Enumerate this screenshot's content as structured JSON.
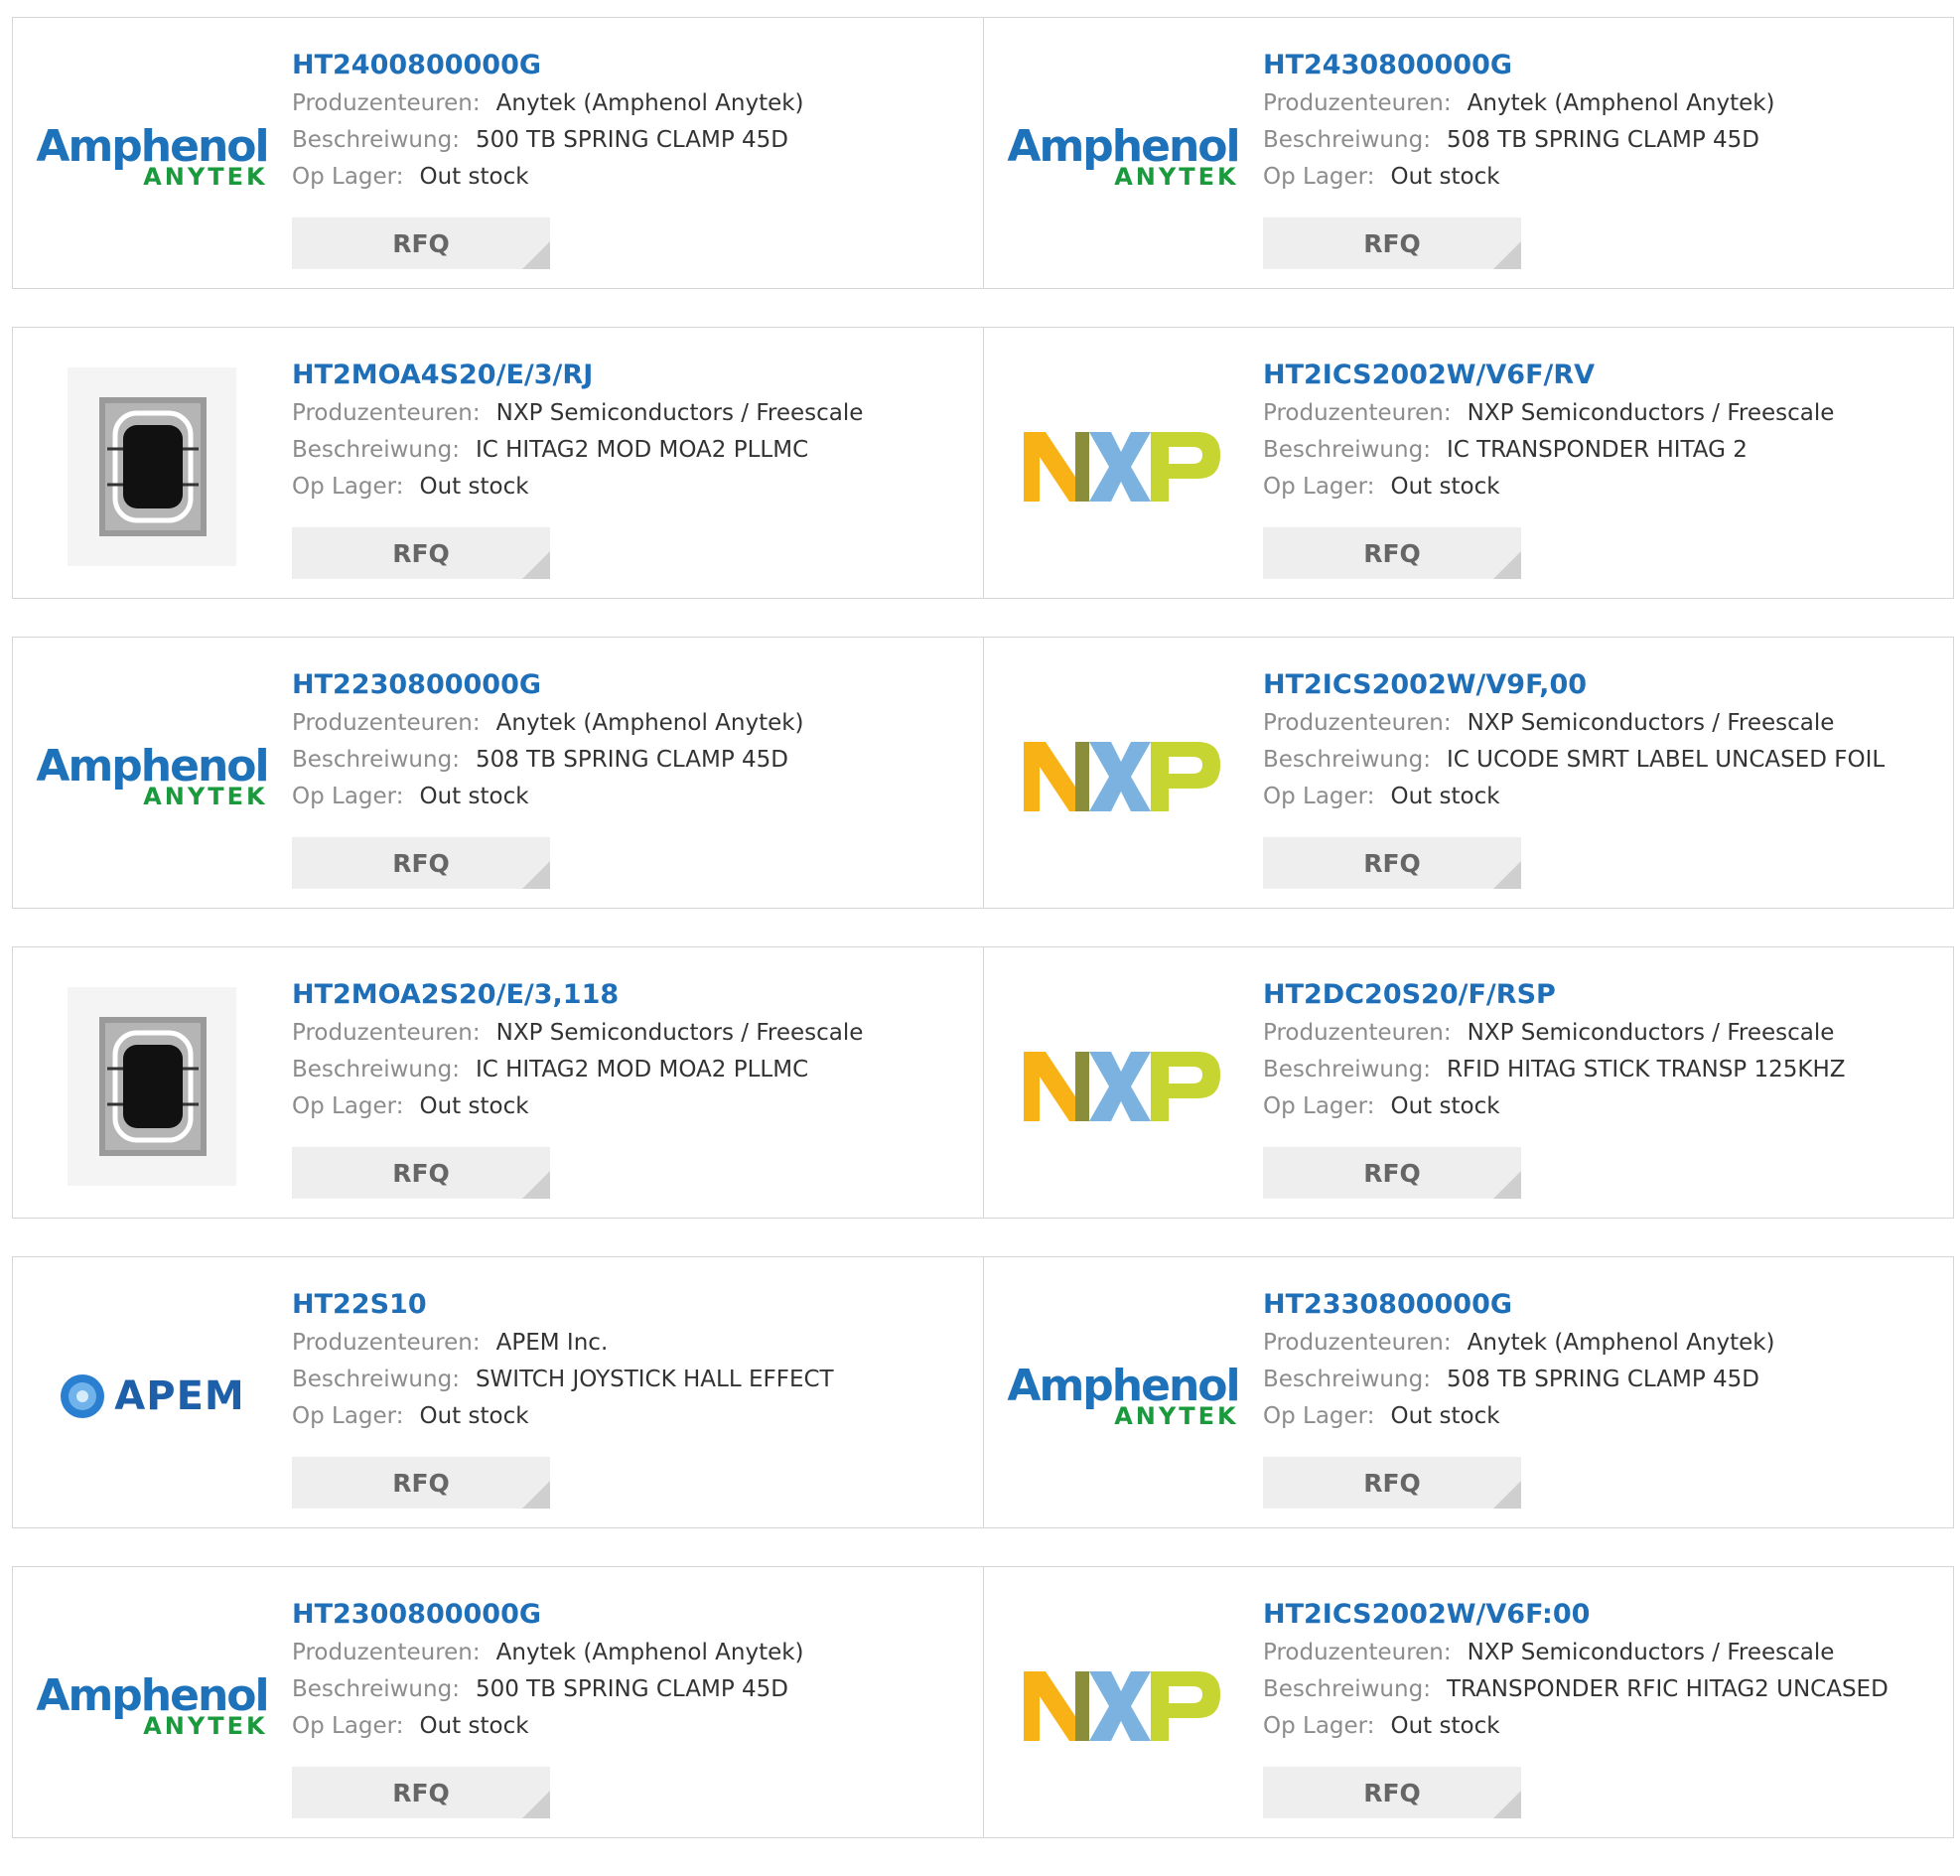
{
  "labels": {
    "manufacturer": "Produzenteuren:",
    "description": "Beschreiwung:",
    "stock": "Op Lager:",
    "rfq": "RFQ"
  },
  "logos": {
    "amphenol_top": "Amphenol",
    "amphenol_bottom": "ANYTEK",
    "apem": "APEM"
  },
  "products": [
    {
      "part": "HT2400800000G",
      "manufacturer": "Anytek (Amphenol Anytek)",
      "description": "500 TB SPRING CLAMP 45D",
      "stock": "Out stock",
      "logo": "amphenol-anytek-logo"
    },
    {
      "part": "HT2430800000G",
      "manufacturer": "Anytek (Amphenol Anytek)",
      "description": "508 TB SPRING CLAMP 45D",
      "stock": "Out stock",
      "logo": "amphenol-anytek-logo"
    },
    {
      "part": "HT2MOA4S20/E/3/RJ",
      "manufacturer": "NXP Semiconductors / Freescale",
      "description": "IC HITAG2 MOD MOA2 PLLMC",
      "stock": "Out stock",
      "logo": "chip-module-image"
    },
    {
      "part": "HT2ICS2002W/V6F/RV",
      "manufacturer": "NXP Semiconductors / Freescale",
      "description": "IC TRANSPONDER HITAG 2",
      "stock": "Out stock",
      "logo": "nxp-logo"
    },
    {
      "part": "HT2230800000G",
      "manufacturer": "Anytek (Amphenol Anytek)",
      "description": "508 TB SPRING CLAMP 45D",
      "stock": "Out stock",
      "logo": "amphenol-anytek-logo"
    },
    {
      "part": "HT2ICS2002W/V9F,00",
      "manufacturer": "NXP Semiconductors / Freescale",
      "description": "IC UCODE SMRT LABEL UNCASED FOIL",
      "stock": "Out stock",
      "logo": "nxp-logo"
    },
    {
      "part": "HT2MOA2S20/E/3,118",
      "manufacturer": "NXP Semiconductors / Freescale",
      "description": "IC HITAG2 MOD MOA2 PLLMC",
      "stock": "Out stock",
      "logo": "chip-module-image"
    },
    {
      "part": "HT2DC20S20/F/RSP",
      "manufacturer": "NXP Semiconductors / Freescale",
      "description": "RFID HITAG STICK TRANSP 125KHZ",
      "stock": "Out stock",
      "logo": "nxp-logo"
    },
    {
      "part": "HT22S10",
      "manufacturer": "APEM Inc.",
      "description": "SWITCH JOYSTICK HALL EFFECT",
      "stock": "Out stock",
      "logo": "apem-logo"
    },
    {
      "part": "HT2330800000G",
      "manufacturer": "Anytek (Amphenol Anytek)",
      "description": "508 TB SPRING CLAMP 45D",
      "stock": "Out stock",
      "logo": "amphenol-anytek-logo"
    },
    {
      "part": "HT2300800000G",
      "manufacturer": "Anytek (Amphenol Anytek)",
      "description": "500 TB SPRING CLAMP 45D",
      "stock": "Out stock",
      "logo": "amphenol-anytek-logo"
    },
    {
      "part": "HT2ICS2002W/V6F:00",
      "manufacturer": "NXP Semiconductors / Freescale",
      "description": "TRANSPONDER RFIC HITAG2 UNCASED",
      "stock": "Out stock",
      "logo": "nxp-logo"
    }
  ]
}
